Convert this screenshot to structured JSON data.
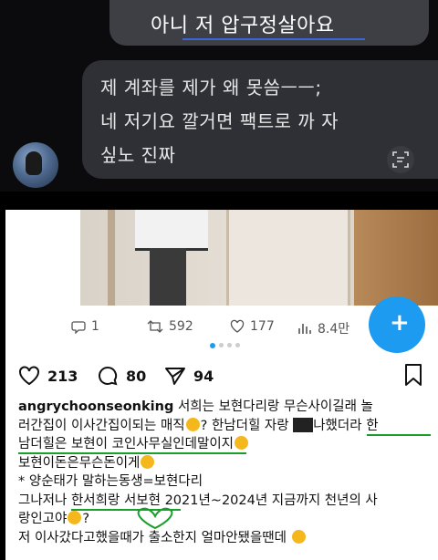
{
  "chat": {
    "message_1": "아니 저 압구정살아요",
    "message_2_lines": [
      "제 계좌를 제가 왜 못씀ㅡㅡ;",
      "네 저기요 깔거면 팩트로 까 자",
      "싶노 진짜"
    ],
    "scan_icon": "scan-text-icon"
  },
  "tweet_stats": {
    "replies": "1",
    "retweets": "592",
    "likes": "177",
    "views": "8.4만"
  },
  "post": {
    "likes": "213",
    "comments": "80",
    "shares": "94",
    "username": "angrychoonseonking",
    "caption_lines": [
      "서희는 보현다리랑 무슨사이길래 놀",
      "러간집이 이사간집이되는 매직",
      "? 한남더힐 자랑 ",
      "나했더라 한",
      "남더힐은 보현이 코인사무실인데말이지",
      "보현이돈은무슨돈이게",
      "* 양순태가 말하는동생=보현다리",
      "그나저나 한서희랑 서보현 2021년~2024년 지금까지 천년의 사",
      "랑인고야",
      "?",
      "저 이사갔다고했을때가 출소한지 얼마안됐을땐데"
    ]
  },
  "colors": {
    "chat_bg": "#0b0b0d",
    "bubble": "#3e3f45",
    "accent_blue": "#1d9bf0",
    "annotation_green": "#1a9f2c",
    "annotation_blue": "#3b66d6"
  }
}
